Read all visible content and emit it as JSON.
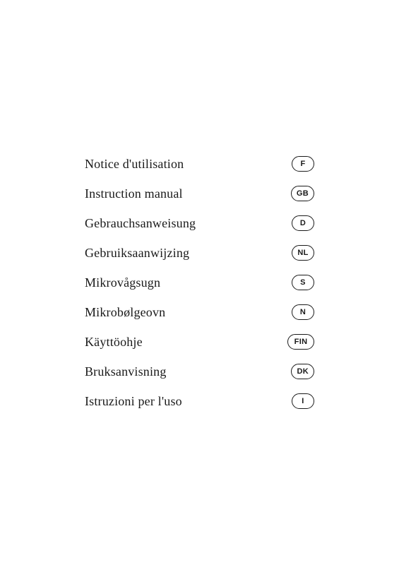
{
  "items": [
    {
      "label": "Notice d'utilisation",
      "badge": "F",
      "wide": false
    },
    {
      "label": "Instruction manual",
      "badge": "GB",
      "wide": false
    },
    {
      "label": "Gebrauchsanweisung",
      "badge": "D",
      "wide": false
    },
    {
      "label": "Gebruiksaanwijzing",
      "badge": "NL",
      "wide": false
    },
    {
      "label": "Mikrovågsugn",
      "badge": "S",
      "wide": false
    },
    {
      "label": "Mikrobølgeovn",
      "badge": "N",
      "wide": false
    },
    {
      "label": "Käyttöohje",
      "badge": "FIN",
      "wide": true
    },
    {
      "label": "Bruksanvisning",
      "badge": "DK",
      "wide": false
    },
    {
      "label": "Istruzioni per l'uso",
      "badge": "I",
      "wide": false
    }
  ]
}
